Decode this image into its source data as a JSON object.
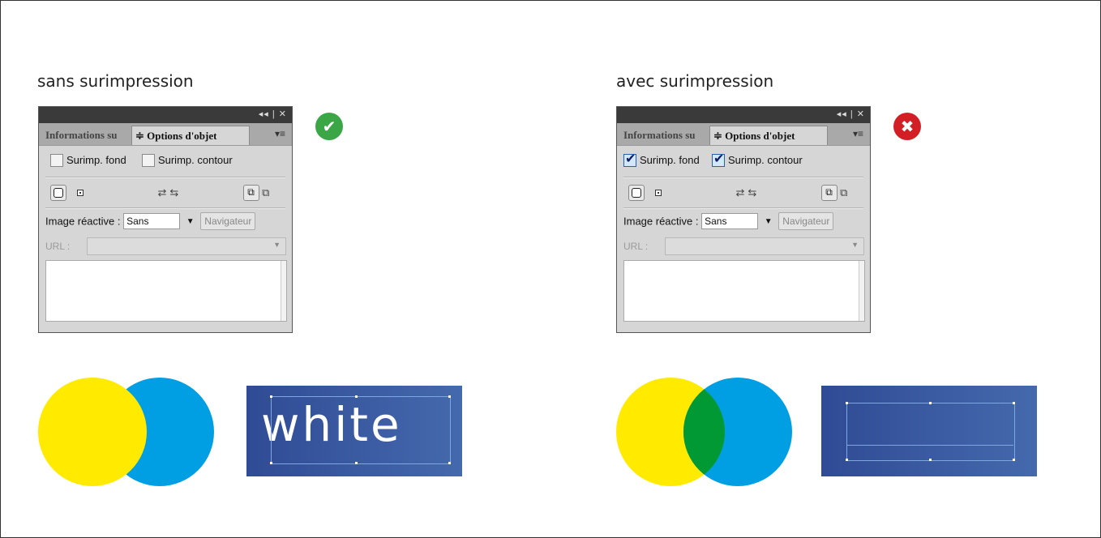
{
  "left": {
    "caption": "sans surimpression",
    "status_icon": "check-circle-icon",
    "status_color": "#3aa646",
    "panel": {
      "window_controls": "◂◂ | ✕",
      "tab_inactive": "Informations su",
      "tab_active": "≑ Options d'objet",
      "tab_menu": "▾≡",
      "checkbox_fill_label": "Surimp. fond",
      "checkbox_fill_checked": false,
      "checkbox_stroke_label": "Surimp. contour",
      "checkbox_stroke_checked": false,
      "image_reactive_label": "Image réactive :",
      "image_reactive_value": "Sans",
      "navigator_button": "Navigateur",
      "url_label": "URL :"
    },
    "text_sample": "white"
  },
  "right": {
    "caption": "avec surimpression",
    "status_icon": "x-circle-icon",
    "status_color": "#d21f26",
    "panel": {
      "window_controls": "◂◂ | ✕",
      "tab_inactive": "Informations su",
      "tab_active": "≑ Options d'objet",
      "tab_menu": "▾≡",
      "checkbox_fill_label": "Surimp. fond",
      "checkbox_fill_checked": true,
      "checkbox_stroke_label": "Surimp. contour",
      "checkbox_stroke_checked": true,
      "image_reactive_label": "Image réactive :",
      "image_reactive_value": "Sans",
      "navigator_button": "Navigateur",
      "url_label": "URL :"
    }
  },
  "colors": {
    "yellow": "#ffea00",
    "cyan": "#009fe3",
    "overlap_green": "#009933",
    "blue_gradient_start": "#2f4b95",
    "blue_gradient_end": "#4569ad"
  }
}
